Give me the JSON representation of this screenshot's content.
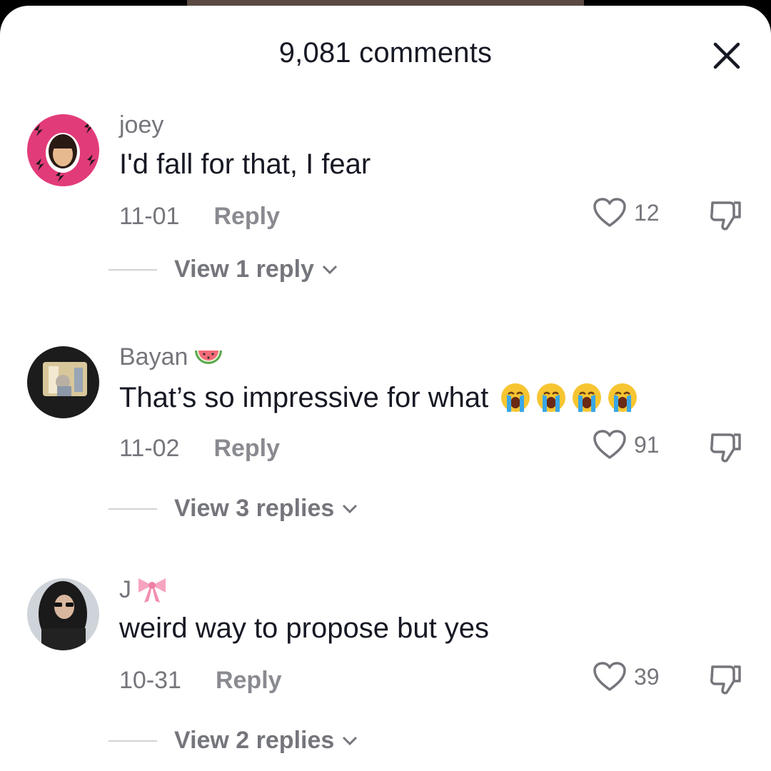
{
  "header": {
    "title": "9,081 comments",
    "close_icon": "close-icon"
  },
  "colors": {
    "text_primary": "#161823",
    "text_secondary": "#75767c",
    "sheet_bg": "#ffffff"
  },
  "comments": [
    {
      "username": "joey",
      "text": "I'd fall for that, I fear",
      "date": "11-01",
      "reply_label": "Reply",
      "likes": "12",
      "view_replies": "View 1 reply",
      "avatar": "avatar-pink-lightning"
    },
    {
      "username": "Bayan",
      "username_emoji": "watermelon",
      "text": "That’s so impressive for what",
      "text_emoji": "loudly-crying-face x4",
      "date": "11-02",
      "reply_label": "Reply",
      "likes": "91",
      "view_replies": "View 3 replies",
      "avatar": "avatar-dark-screen"
    },
    {
      "username": "J",
      "username_emoji": "ribbon",
      "text": "weird way to propose but yes",
      "date": "10-31",
      "reply_label": "Reply",
      "likes": "39",
      "view_replies": "View 2 replies",
      "avatar": "avatar-dark-photo"
    }
  ]
}
